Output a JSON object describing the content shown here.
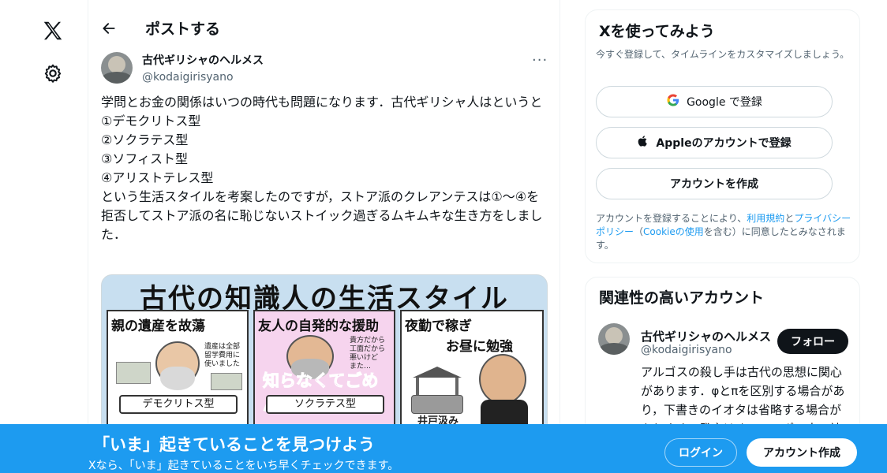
{
  "nav": {
    "logo_icon": "x-logo-icon",
    "settings_icon": "gear-icon"
  },
  "header": {
    "title": "ポストする",
    "back_icon": "arrow-left-icon"
  },
  "post": {
    "author_name": "古代ギリシャのヘルメス",
    "author_handle": "@kodaigirisyano",
    "more_label": "···",
    "text": "学問とお金の関係はいつの時代も問題になります．古代ギリシャ人はというと\n①デモクリトス型\n②ソクラテス型\n③ソフィスト型\n④アリストテレス型\nという生活スタイルを考案したのですが，ストア派のクレアンテスは①〜④を拒否してストア派の名に恥じないストイック過ぎるムキムキな生き方をしました．",
    "image": {
      "title": "古代の知識人の生活スタイル",
      "panel1": {
        "title": "親の遺産を故蕩",
        "note": "遺産は全部\n留学費用に\n使いました",
        "label": "デモクリトス型"
      },
      "panel2": {
        "title": "友人の自発的な援助",
        "note": "貴方だから\n工面だから\n悪いけど\nまた…",
        "pink": "知らなくてごめん",
        "label": "ソクラテス型"
      },
      "panel3": {
        "title": "夜勤で稼ぎ",
        "title2": "お昼に勉強",
        "label": "井戸汲み"
      }
    }
  },
  "signup_card": {
    "title": "Xを使ってみよう",
    "subtitle": "今すぐ登録して、タイムラインをカスタマイズしましょう。",
    "google_label": "Google で登録",
    "apple_label": "Appleのアカウントで登録",
    "create_label": "アカウントを作成",
    "legal_pre": "アカウントを登録することにより、",
    "terms": "利用規約",
    "and": "と",
    "privacy": "プライバシーポリシー",
    "paren_open": "（",
    "cookie": "Cookieの使用",
    "legal_post": "を含む）に同意したとみなされます。"
  },
  "related": {
    "title": "関連性の高いアカウント",
    "name": "古代ギリシャのヘルメス",
    "handle": "@kodaigirisyano",
    "follow_label": "フォロー",
    "bio": "アルゴスの殺し手は古代の思想に関心があります．φとπを区別する場合があり，下書きのイオタは省略する場合があります．発言はオリュンポス十二神"
  },
  "banner": {
    "headline": "「いま」起きていることを見つけよう",
    "sub": "Xなら、「いま」起きていることをいち早くチェックできます。",
    "login_label": "ログイン",
    "signup_label": "アカウント作成"
  }
}
